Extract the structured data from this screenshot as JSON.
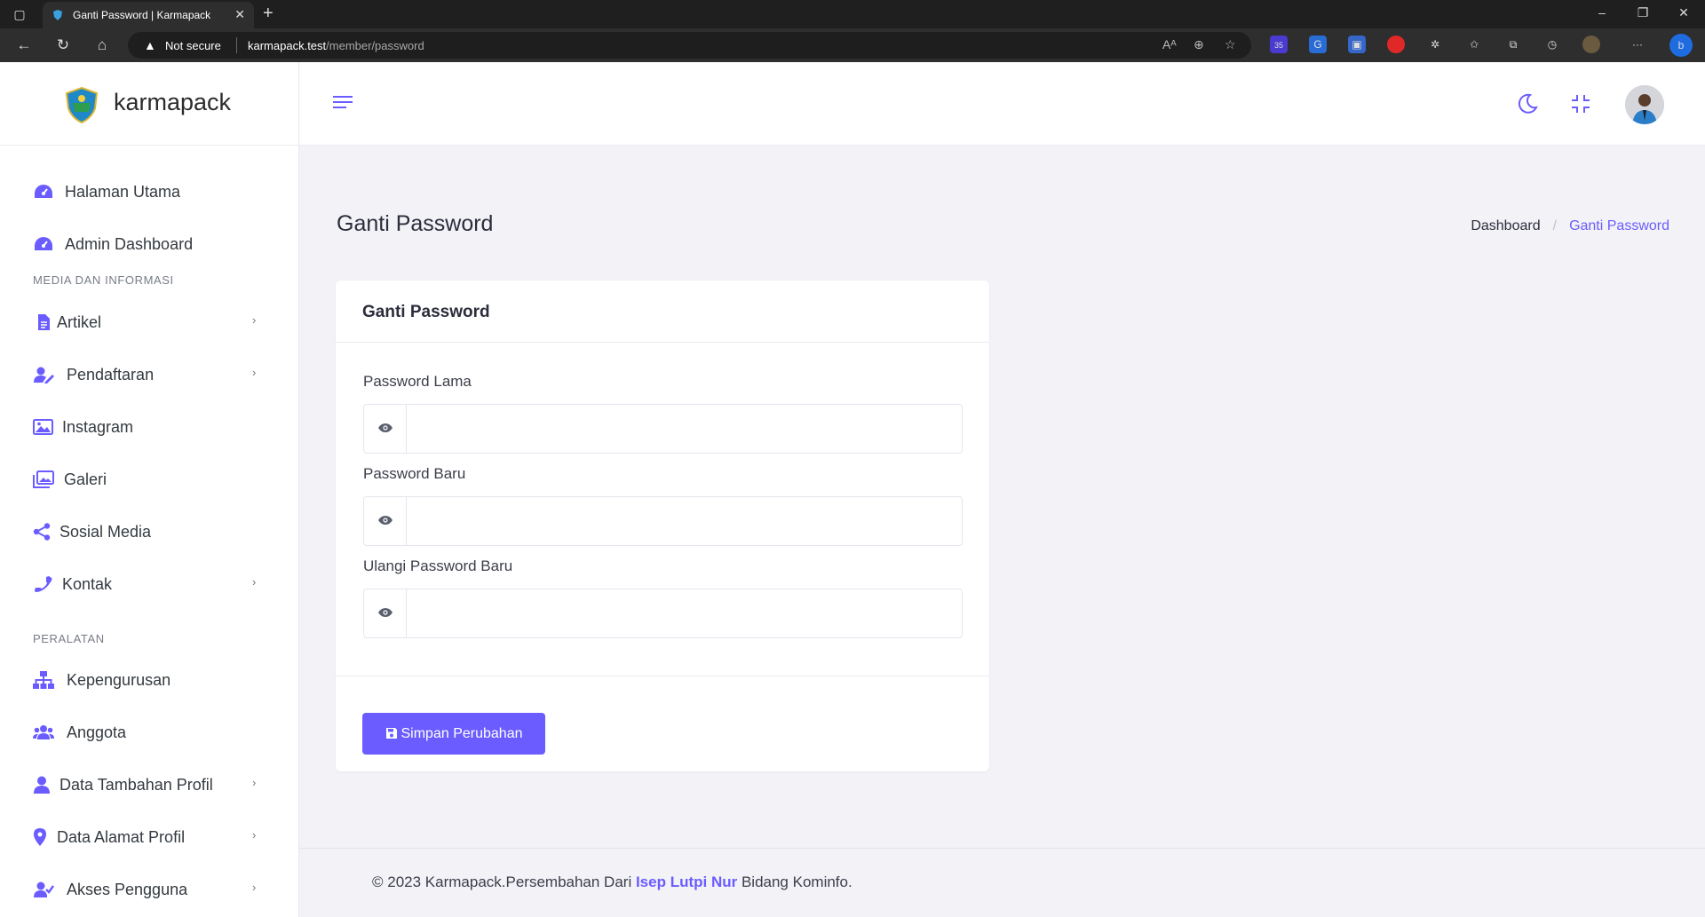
{
  "browser": {
    "tab_title": "Ganti Password | Karmapack",
    "security_label": "Not secure",
    "url_host": "karmapack.test",
    "url_path": "/member/password",
    "extension_badge": "35"
  },
  "brand": {
    "name": "karmapack"
  },
  "sidebar": {
    "top_items": [
      {
        "label": "Halaman Utama",
        "icon": "dashboard-gauge-icon"
      },
      {
        "label": "Admin Dashboard",
        "icon": "dashboard-gauge-icon"
      }
    ],
    "section1_heading": "MEDIA DAN INFORMASI",
    "section1_items": [
      {
        "label": "Artikel",
        "icon": "file-icon",
        "has_submenu": true
      },
      {
        "label": "Pendaftaran",
        "icon": "user-edit-icon",
        "has_submenu": true
      },
      {
        "label": "Instagram",
        "icon": "image-icon",
        "has_submenu": false
      },
      {
        "label": "Galeri",
        "icon": "images-icon",
        "has_submenu": false
      },
      {
        "label": "Sosial Media",
        "icon": "share-icon",
        "has_submenu": false
      },
      {
        "label": "Kontak",
        "icon": "phone-icon",
        "has_submenu": true
      }
    ],
    "section2_heading": "PERALATAN",
    "section2_items": [
      {
        "label": "Kepengurusan",
        "icon": "sitemap-icon",
        "has_submenu": false
      },
      {
        "label": "Anggota",
        "icon": "users-icon",
        "has_submenu": false
      },
      {
        "label": "Data Tambahan Profil",
        "icon": "user-icon",
        "has_submenu": true
      },
      {
        "label": "Data Alamat Profil",
        "icon": "map-pin-icon",
        "has_submenu": true
      },
      {
        "label": "Akses Pengguna",
        "icon": "user-check-icon",
        "has_submenu": true
      }
    ]
  },
  "header": {
    "page_title": "Ganti Password",
    "breadcrumb": {
      "home": "Dashboard",
      "current": "Ganti Password"
    }
  },
  "form": {
    "card_title": "Ganti Password",
    "fields": [
      {
        "label": "Password Lama",
        "value": ""
      },
      {
        "label": "Password Baru",
        "value": ""
      },
      {
        "label": "Ulangi Password Baru",
        "value": ""
      }
    ],
    "submit_label": "Simpan Perubahan"
  },
  "footer": {
    "prefix": "© 2023 Karmapack.Persembahan Dari ",
    "author": "Isep Lutpi Nur",
    "suffix": " Bidang Kominfo."
  },
  "colors": {
    "accent": "#6b5cff",
    "background": "#f2f2f7"
  }
}
